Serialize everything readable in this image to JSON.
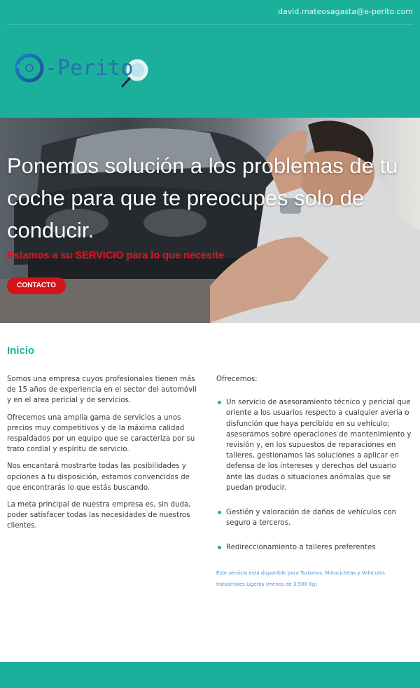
{
  "header": {
    "email": "david.mateosagasta@e-perito.com",
    "logo_text": "-Perito",
    "logo_letter": "e"
  },
  "hero": {
    "title": "Ponemos solución a los problemas de tu coche para que te preocupes solo de conducir.",
    "subtitle": "Estamos a su SERVICIO para lo que necesite",
    "button_label": "CONTACTO"
  },
  "main": {
    "section_title": "Inicio",
    "left_paragraphs": [
      "Somos una empresa cuyos profesionales tienen más de 15 años de experiencia en el sector del automóvil y en el area pericial y de servicios.",
      "Ofrecemos una amplia gama de servicios a unos precios muy competitivos y de la máxima calidad respaldados por un equipo que se caracteriza por su trato cordial y espíritu de servicio.",
      "Nos encantará mostrarte todas las posibilidades y opciones a tu disposición, estamos convencidos de que encontrarás lo que estás buscando.",
      "La meta principal de nuestra empresa es, sin duda, poder satisfacer todas las necesidades de nuestros clientes."
    ],
    "offers_intro": "Ofrecemos:",
    "offers": [
      "Un servicio de asesoramiento técnico y pericial que oriente a los usuarios respecto a cualquier avería o disfunción que haya percibido en su vehículo; asesoramos sobre operaciones de mantenimiento y revisión y, en los supuestos de reparaciones en talleres, gestionamos las soluciones a aplicar en defensa de los intereses y derechos del usuario ante las dudas o situaciones anómalas  que se puedan producir.",
      "Gestión y valoración de daños de vehículos con seguro a terceros.",
      "Redireccionamiento a talleres preferentes"
    ],
    "note": "Este servicio está disponible para Turismos, Motocicletas y Vehículos Industriales Ligeros (menos de 3.500 Kg)"
  },
  "colors": {
    "brand_teal": "#1bb09c",
    "accent_red": "#d6131a",
    "logo_blue": "#2a6fb0"
  }
}
